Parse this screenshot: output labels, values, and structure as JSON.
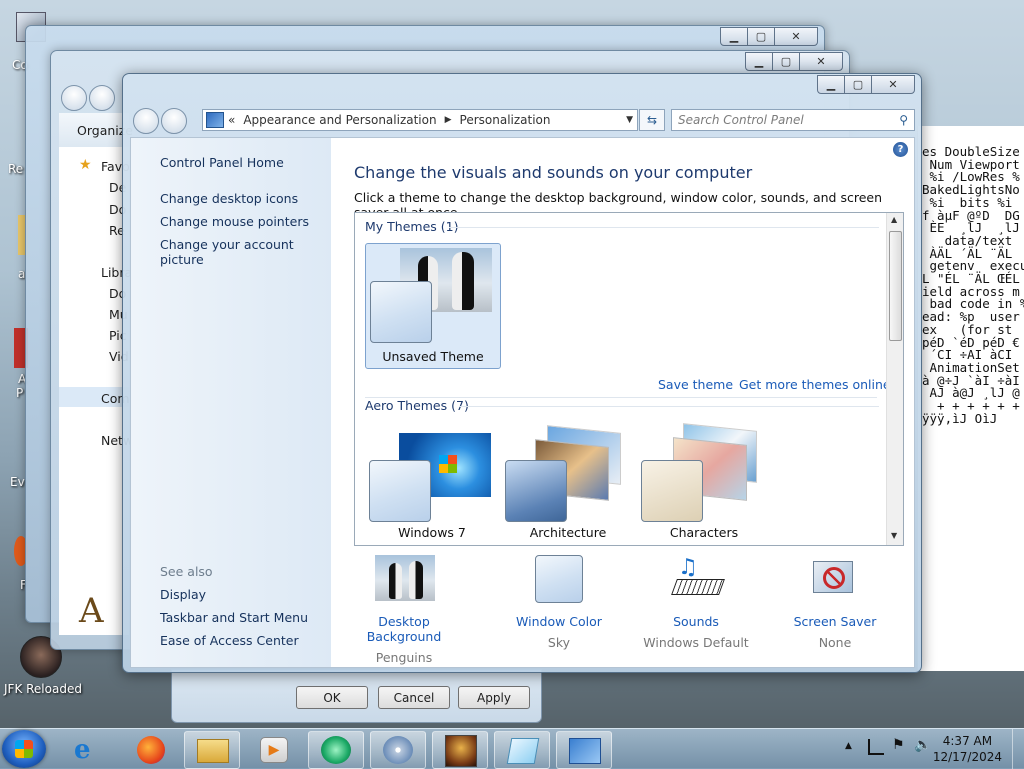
{
  "desktop": {
    "icons": [
      {
        "label": "Co"
      },
      {
        "label": "Re"
      },
      {
        "label": "a"
      },
      {
        "label": "A"
      },
      {
        "label": "P"
      },
      {
        "label": "Ev"
      },
      {
        "label": "F"
      },
      {
        "label": "JFK Reloaded"
      }
    ]
  },
  "console_text": "es DoubleSize\n Num Viewport\n %i /LowRes %\nBakedLightsNo\n %i  bits %i\nf àµF @ºD  DG\n ÈE  ¸lJ  ¸lJ M\n   data/text\n ÀÄL ´ÄL ¨ÄL\n getenv  execu\nL \"ÉL ¨ÄL ŒÉL\nield across m\n bad code in %\nead: %p  user\nex   (for st\npéD `éD péD €\n ´CI ÷AI àCI\n AnimationSet\nà @÷J `àI ÷àI\n AJ à@J ¸lJ @\n  + + + + + +\nÿÿÿ,ìJ OìJ",
  "explorer": {
    "toolbar_label": "Organize",
    "nav_items": [
      "Favo",
      "De",
      "Do",
      "Re",
      "Libra",
      "Do",
      "Mu",
      "Pic",
      "Vid",
      "Com",
      "Netw"
    ]
  },
  "dialog": {
    "ok": "OK",
    "cancel": "Cancel",
    "apply": "Apply"
  },
  "window": {
    "breadcrumb_prefix": "«",
    "breadcrumb": [
      "Appearance and Personalization",
      "Personalization"
    ],
    "search_placeholder": "Search Control Panel"
  },
  "left_pane": {
    "home": "Control Panel Home",
    "links": [
      "Change desktop icons",
      "Change mouse pointers",
      "Change your account picture"
    ],
    "see_also_label": "See also",
    "see_also": [
      "Display",
      "Taskbar and Start Menu",
      "Ease of Access Center"
    ]
  },
  "content": {
    "title": "Change the visuals and sounds on your computer",
    "subtitle": "Click a theme to change the desktop background, window color, sounds, and screen saver all at once.",
    "my_themes_header": "My Themes (1)",
    "unsaved_theme": "Unsaved Theme",
    "save_theme": "Save theme",
    "get_more": "Get more themes online",
    "aero_header": "Aero Themes (7)",
    "aero_themes": [
      "Windows 7",
      "Architecture",
      "Characters"
    ]
  },
  "bottom": [
    {
      "label": "Desktop Background",
      "value": "Penguins"
    },
    {
      "label": "Window Color",
      "value": "Sky"
    },
    {
      "label": "Sounds",
      "value": "Windows Default"
    },
    {
      "label": "Screen Saver",
      "value": "None"
    }
  ],
  "taskbar": {
    "time": "4:37 AM",
    "date": "12/17/2024"
  }
}
